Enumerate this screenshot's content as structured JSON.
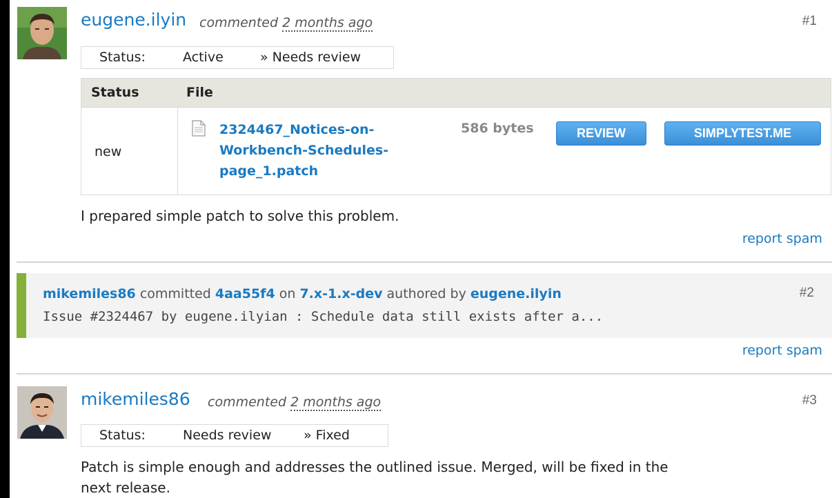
{
  "comments": [
    {
      "author": "eugene.ilyin",
      "verb": "commented",
      "time_ago": "2 months ago",
      "number": "#1",
      "status": {
        "label": "Status:",
        "from": "Active",
        "to": "» Needs review"
      },
      "files": {
        "headers": [
          "Status",
          "File"
        ],
        "rows": [
          {
            "status": "new",
            "filename_lines": [
              "2324467_Notices-on-",
              "Workbench-Schedules-",
              "page_1.patch"
            ],
            "size": "586 bytes",
            "buttons": [
              "REVIEW",
              "SIMPLYTEST.ME"
            ]
          }
        ]
      },
      "body": "I prepared simple patch to solve this problem.",
      "report_spam": "report spam"
    },
    {
      "number": "#2",
      "commit": {
        "committer": "mikemiles86",
        "verb": "committed",
        "hash": "4aa55f4",
        "on": "on",
        "branch": "7.x-1.x-dev",
        "authored_by": "authored by",
        "author": "eugene.ilyin",
        "message": "Issue #2324467 by eugene.ilyian : Schedule data still exists after a..."
      },
      "report_spam": "report spam"
    },
    {
      "author": "mikemiles86",
      "verb": "commented",
      "time_ago": "2 months ago",
      "number": "#3",
      "status": {
        "label": "Status:",
        "from": "Needs review",
        "to": "» Fixed"
      },
      "body_lines": [
        "Patch is simple enough and addresses the outlined issue. Merged, will be fixed in the",
        "next release."
      ]
    }
  ],
  "colors": {
    "link": "#1a7ac2",
    "commit_bar": "#85b13a",
    "table_header": "#e7e6de",
    "button": "#3a8fd8"
  },
  "icons": [
    "avatar-eugene",
    "file-icon",
    "avatar-mikemiles"
  ]
}
